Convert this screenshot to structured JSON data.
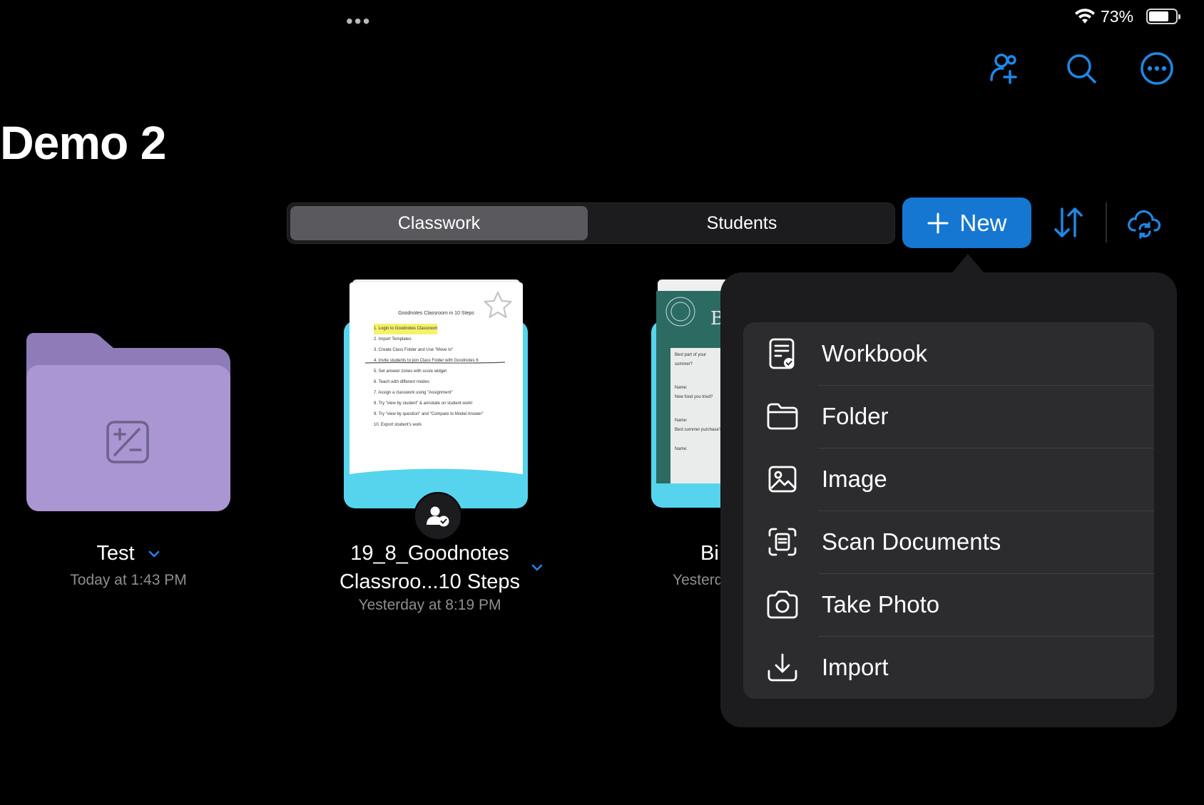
{
  "status_bar": {
    "dots": "•••",
    "battery_percent": "73%"
  },
  "page": {
    "title": "Demo 2"
  },
  "segmented": {
    "tabs": [
      "Classwork",
      "Students"
    ],
    "active": "Classwork"
  },
  "toolbar": {
    "new_label": "New"
  },
  "items": [
    {
      "name": "Test",
      "date": "Today at 1:43 PM",
      "kind": "folder"
    },
    {
      "name_line1": "19_8_Goodnotes",
      "name_line2": "Classroo...10 Steps",
      "date": "Yesterday at 8:19 PM",
      "kind": "notebook"
    },
    {
      "name": "Bi",
      "date": "Yesterd",
      "kind": "notebook"
    }
  ],
  "doc_preview": {
    "heading": "Goodnotes Classroom in 10 Steps",
    "lines": [
      "1. Login to Goodnotes Classroom",
      "2. Import Templates",
      "3. Create Class Folder and Use \"Move to\"",
      "4. Invite students to join Class Folder with Goodnotes 6",
      "5. Set answer zones with score widget",
      "6. Teach with different modes",
      "7. Assign a classwork using \"Assignment\"",
      "8. Try \"view by student\" & annotate on student work!",
      "9. Try \"view by question\" and \"Compare to Model Answer\"",
      "10. Export student's work"
    ]
  },
  "doc2_preview": {
    "letter": "B",
    "lines": [
      "Best part of your summer?",
      "Name:",
      "New food you tried?",
      "Name:",
      "Best summer purchase?",
      "Name:"
    ]
  },
  "menu": {
    "items": [
      {
        "label": "Workbook",
        "icon": "workbook-icon"
      },
      {
        "label": "Folder",
        "icon": "folder-icon"
      },
      {
        "label": "Image",
        "icon": "image-icon"
      },
      {
        "label": "Scan Documents",
        "icon": "scan-icon"
      },
      {
        "label": "Take Photo",
        "icon": "camera-icon"
      },
      {
        "label": "Import",
        "icon": "import-icon"
      }
    ]
  },
  "colors": {
    "accent": "#1677d2",
    "folder": "#a996d2",
    "notebook_cover": "#56d4ee",
    "menu_bg": "#1c1c1e",
    "menu_list_bg": "#2c2c2e"
  }
}
